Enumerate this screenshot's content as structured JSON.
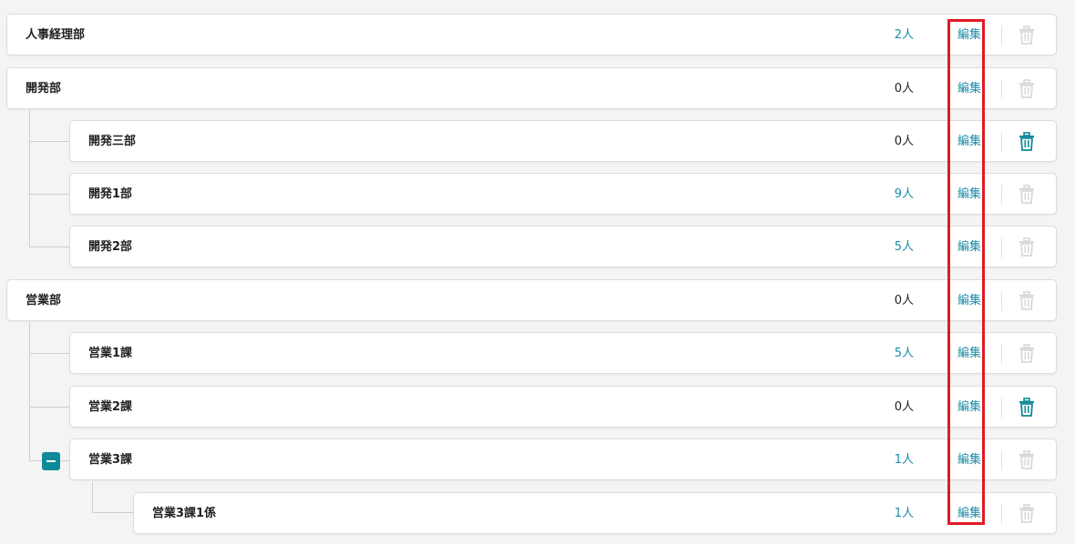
{
  "departments": [
    {
      "name": "人事経理部",
      "count": "2人",
      "count_link": true,
      "edit": "編集",
      "trash_active": false
    },
    {
      "name": "開発部",
      "count": "0人",
      "count_link": false,
      "edit": "編集",
      "trash_active": false
    },
    {
      "name": "開発三部",
      "count": "0人",
      "count_link": false,
      "edit": "編集",
      "trash_active": true
    },
    {
      "name": "開発1部",
      "count": "9人",
      "count_link": true,
      "edit": "編集",
      "trash_active": false
    },
    {
      "name": "開発2部",
      "count": "5人",
      "count_link": true,
      "edit": "編集",
      "trash_active": false
    },
    {
      "name": "営業部",
      "count": "0人",
      "count_link": false,
      "edit": "編集",
      "trash_active": false
    },
    {
      "name": "営業1課",
      "count": "5人",
      "count_link": true,
      "edit": "編集",
      "trash_active": false
    },
    {
      "name": "営業2課",
      "count": "0人",
      "count_link": false,
      "edit": "編集",
      "trash_active": true
    },
    {
      "name": "営業3課",
      "count": "1人",
      "count_link": true,
      "edit": "編集",
      "trash_active": false
    },
    {
      "name": "営業3課1係",
      "count": "1人",
      "count_link": true,
      "edit": "編集",
      "trash_active": false
    }
  ],
  "icons": {
    "trash": "trash-icon",
    "collapse": "minus-square-icon"
  },
  "colors": {
    "accent": "#1a8ba8",
    "trash_active": "#0f8a99",
    "trash_disabled": "#d9d9d9",
    "highlight": "#e01b24"
  }
}
